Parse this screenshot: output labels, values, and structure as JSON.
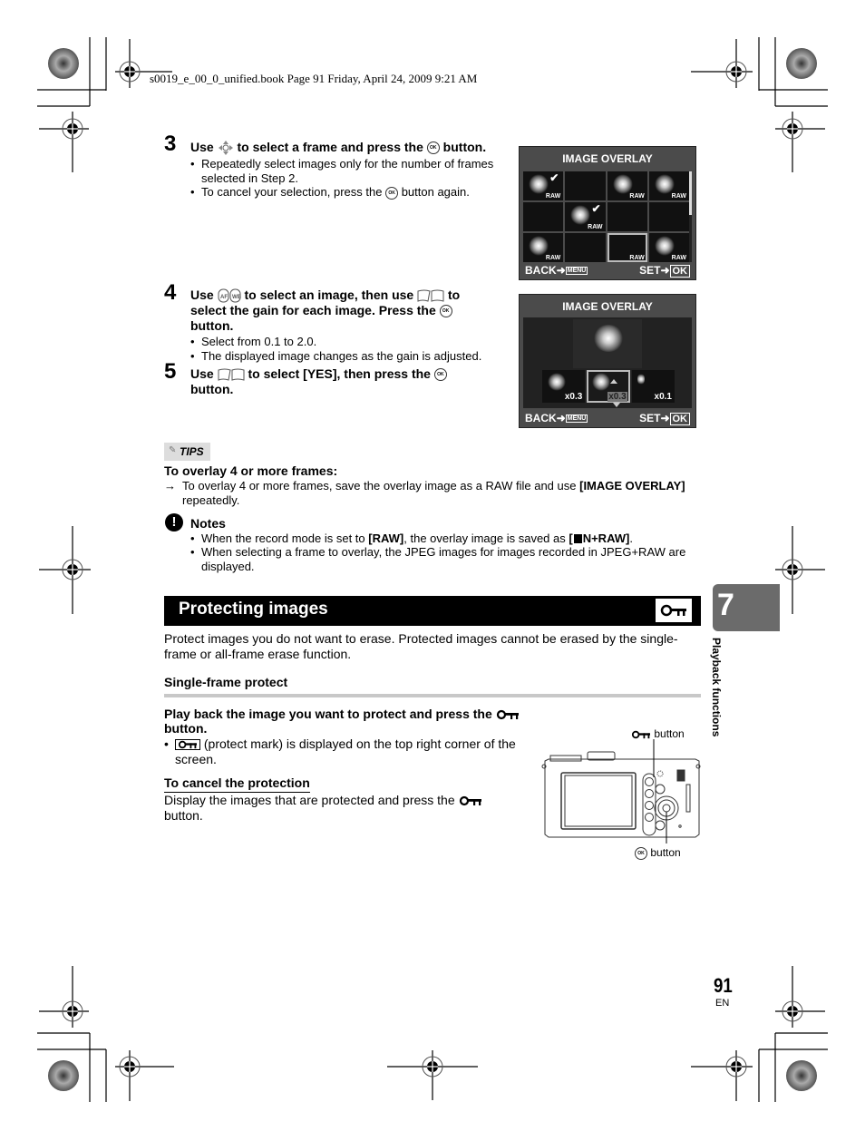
{
  "header": {
    "book_info": "s0019_e_00_0_unified.book  Page 91  Friday, April 24, 2009  9:21 AM"
  },
  "steps": [
    {
      "number": "3",
      "title_parts": [
        "Use ",
        " to select a frame and press the ",
        " button."
      ],
      "bullets": [
        "Repeatedly select images only for the number of frames selected in Step 2.",
        "To cancel your selection, press the",
        "button again."
      ]
    },
    {
      "number": "4",
      "title_line1_parts": [
        "Use ",
        " to select an image, then use ",
        " to"
      ],
      "title_line2": "select the gain for each image. Press the",
      "title_line3": "button.",
      "bullets": [
        "Select from 0.1 to 2.0.",
        "The displayed image changes as the gain is adjusted."
      ]
    },
    {
      "number": "5",
      "title_parts": [
        "Use ",
        " to select [YES], then press the "
      ],
      "title_line2": "button."
    }
  ],
  "screen1": {
    "title": "IMAGE OVERLAY",
    "back_label": "BACK",
    "menu_label": "MENU",
    "set_label": "SET",
    "ok_label": "OK",
    "raw_label": "RAW",
    "thumbnails": [
      {
        "raw": true,
        "checked": true,
        "burst": true
      },
      {
        "raw": false,
        "checked": false,
        "burst": false
      },
      {
        "raw": true,
        "checked": false,
        "burst": true
      },
      {
        "raw": true,
        "checked": false,
        "burst": true
      },
      {
        "raw": false,
        "checked": false,
        "burst": false
      },
      {
        "raw": true,
        "checked": true,
        "burst": true
      },
      {
        "raw": false,
        "checked": false,
        "burst": false
      },
      {
        "raw": false,
        "checked": false,
        "burst": false
      },
      {
        "raw": true,
        "checked": false,
        "burst": true
      },
      {
        "raw": false,
        "checked": false,
        "burst": false
      },
      {
        "raw": true,
        "checked": false,
        "burst": false,
        "selected": true
      },
      {
        "raw": true,
        "checked": false,
        "burst": true
      }
    ]
  },
  "screen2": {
    "title": "IMAGE OVERLAY",
    "gains": [
      "x0.3",
      "x0.3",
      "x0.1"
    ],
    "selected_index": 1,
    "back_label": "BACK",
    "menu_label": "MENU",
    "set_label": "SET",
    "ok_label": "OK"
  },
  "tips": {
    "label": "TIPS",
    "heading": "To overlay 4 or more frames:",
    "arrow": "→",
    "text_a": "To overlay 4 or more frames, save the overlay image as a RAW file and use ",
    "text_bold": "[IMAGE OVERLAY]",
    "text_b": "repeatedly."
  },
  "notes": {
    "label": "Notes",
    "bullet1_a": "When the record mode is set to ",
    "bullet1_bold1": "[RAW]",
    "bullet1_b": ", the overlay image is saved as ",
    "bullet1_bold2": "[",
    "bullet1_bold3": "N+RAW]",
    "bullet1_c": ".",
    "bullet2_line1": "When selecting a frame to overlay, the JPEG images for images recorded in JPEG+RAW are",
    "bullet2_line2": "displayed."
  },
  "section": {
    "title": "Protecting images",
    "intro_line1": "Protect images you do not want to erase. Protected images cannot be erased by the single-",
    "intro_line2": "frame or all-frame erase function.",
    "subheading": "Single-frame protect",
    "instruction_line1": "Play back the image you want to protect and press the",
    "instruction_line2": "button.",
    "bullet_line1": "(protect mark) is displayed on the top right corner of the",
    "bullet_line2": "screen.",
    "cancel_heading": "To cancel the protection",
    "cancel_line1": "Display the images that are protected and press the",
    "cancel_line2": "button."
  },
  "camera_figure": {
    "protect_button_label": "button",
    "ok_button_label": "button"
  },
  "chapter_tab": {
    "number": "7",
    "label": "Playback functions"
  },
  "footer": {
    "page_number": "91",
    "language": "EN"
  }
}
